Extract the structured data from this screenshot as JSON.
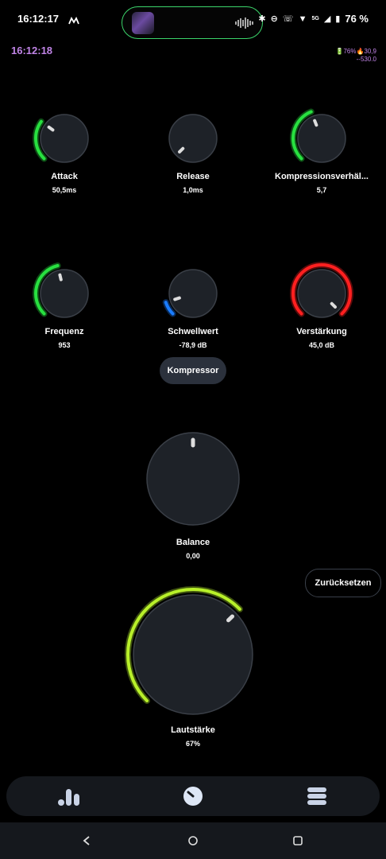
{
  "status_bar": {
    "time": "16:12:17",
    "battery": "76 %",
    "network": "5G"
  },
  "overlay": {
    "clock": "16:12:18",
    "battery_line": "🔋76%🔥30,9",
    "current_line": "--530.0"
  },
  "knobs": [
    {
      "id": "attack",
      "label": "Attack",
      "value": "50,5ms",
      "level": 0.3,
      "color": "#28e040"
    },
    {
      "id": "release",
      "label": "Release",
      "value": "1,0ms",
      "level": 0.0,
      "color": "#28e040"
    },
    {
      "id": "ratio",
      "label": "Kompressionsverhäl...",
      "value": "5,7",
      "level": 0.42,
      "color": "#28e040"
    },
    {
      "id": "frequency",
      "label": "Frequenz",
      "value": "953",
      "level": 0.45,
      "color": "#28e040"
    },
    {
      "id": "threshold",
      "label": "Schwellwert",
      "value": "-78,9 dB",
      "level": 0.1,
      "color": "#1a7cff"
    },
    {
      "id": "gain",
      "label": "Verstärkung",
      "value": "45,0 dB",
      "level": 1.0,
      "color": "#ff2020"
    }
  ],
  "compressor_button": "Kompressor",
  "balance": {
    "label": "Balance",
    "value": "0,00"
  },
  "reset_button": "Zurücksetzen",
  "volume": {
    "label": "Lautstärke",
    "value": "67%",
    "level": 0.67,
    "color": "#b8f02a"
  },
  "nav": {
    "items": [
      "equalizer-icon",
      "dial-icon",
      "menu-icon"
    ]
  },
  "system_nav": [
    "back-icon",
    "home-icon",
    "recents-icon"
  ]
}
